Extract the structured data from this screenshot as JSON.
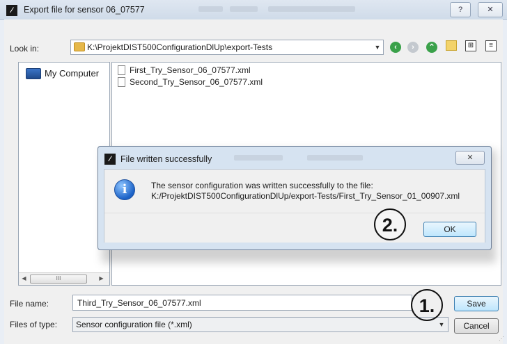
{
  "window": {
    "title": "Export file for sensor 06_07577",
    "help_glyph": "?",
    "close_glyph": "✕"
  },
  "toolbar": {
    "look_in_label": "Look in:",
    "current_path": "K:\\ProjektDIST500ConfigurationDlUp\\export-Tests",
    "icons": [
      "back-icon",
      "forward-icon",
      "up-folder-icon",
      "new-folder-icon",
      "list-view-icon",
      "detail-view-icon"
    ]
  },
  "sidebar": {
    "items": [
      {
        "label": "My Computer",
        "icon": "computer-icon"
      }
    ],
    "scroll_glyph": "III"
  },
  "files": [
    {
      "name": "First_Try_Sensor_06_07577.xml"
    },
    {
      "name": "Second_Try_Sensor_06_07577.xml"
    }
  ],
  "form": {
    "file_name_label": "File name:",
    "file_name_value": "Third_Try_Sensor_06_07577.xml",
    "file_type_label": "Files of type:",
    "file_type_value": "Sensor configuration file (*.xml)",
    "save_label": "Save",
    "cancel_label": "Cancel"
  },
  "message_box": {
    "title": "File written successfully",
    "line1": "The sensor configuration was written successfully to the file:",
    "line2": "K:/ProjektDIST500ConfigurationDlUp/export-Tests/First_Try_Sensor_01_00907.xml",
    "ok_label": "OK",
    "close_glyph": "✕",
    "icon": "info-icon"
  },
  "annotations": [
    {
      "label": "1."
    },
    {
      "label": "2."
    }
  ],
  "colors": {
    "titlebar": "#d5e0ec",
    "dialog_frame": "#d6e3f1",
    "default_button": "#bee6fd",
    "folder": "#e6b84a",
    "info": "#1c62c7"
  }
}
